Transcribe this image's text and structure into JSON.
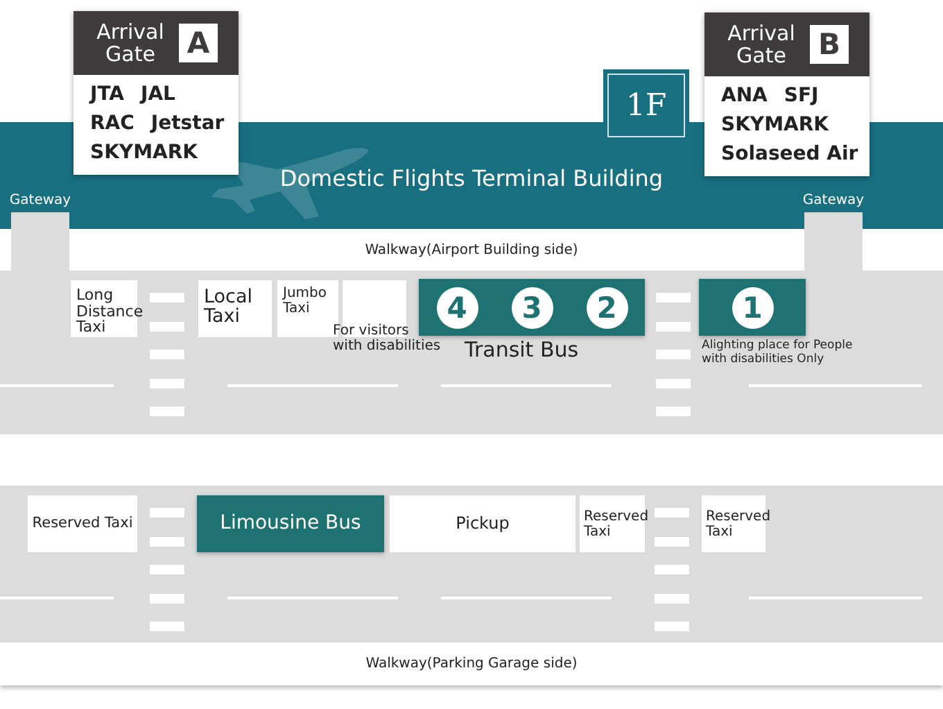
{
  "floor": "1F",
  "building": {
    "title": "Domestic Flights Terminal Building",
    "gateways": [
      "Gateway",
      "Gateway"
    ]
  },
  "gates": [
    {
      "title": "Arrival Gate",
      "letter": "A",
      "airlines": [
        [
          "JTA",
          "JAL"
        ],
        [
          "RAC",
          "Jetstar"
        ],
        [
          "SKYMARK"
        ]
      ]
    },
    {
      "title": "Arrival Gate",
      "letter": "B",
      "airlines": [
        [
          "ANA",
          "SFJ"
        ],
        [
          "SKYMARK"
        ],
        [
          "Solaseed Air"
        ]
      ]
    }
  ],
  "walkways": [
    "Walkway(Airport Building side)",
    "Walkway(Parking Garage side)"
  ],
  "upper_stops": [
    {
      "kind": "taxi",
      "label": "Long Distance Taxi"
    },
    {
      "kind": "taxi",
      "label": "Local Taxi"
    },
    {
      "kind": "taxi",
      "label": "Jumbo Taxi"
    },
    {
      "kind": "accessible",
      "note": [
        "For visitors",
        "with disabilities"
      ]
    },
    {
      "kind": "numbered",
      "numbers": [
        "4",
        "3",
        "2"
      ],
      "caption": "Transit Bus"
    },
    {
      "kind": "numbered",
      "numbers": [
        "1"
      ],
      "note": [
        "Alighting place for People",
        "with disabilities Only"
      ]
    }
  ],
  "lower_stops": [
    {
      "kind": "taxi",
      "label": "Reserved Taxi"
    },
    {
      "kind": "bus",
      "label": "Limousine Bus"
    },
    {
      "kind": "pickup",
      "label": "Pickup"
    },
    {
      "kind": "taxi",
      "label": "Reserved Taxi"
    },
    {
      "kind": "taxi",
      "label": "Reserved Taxi"
    }
  ]
}
